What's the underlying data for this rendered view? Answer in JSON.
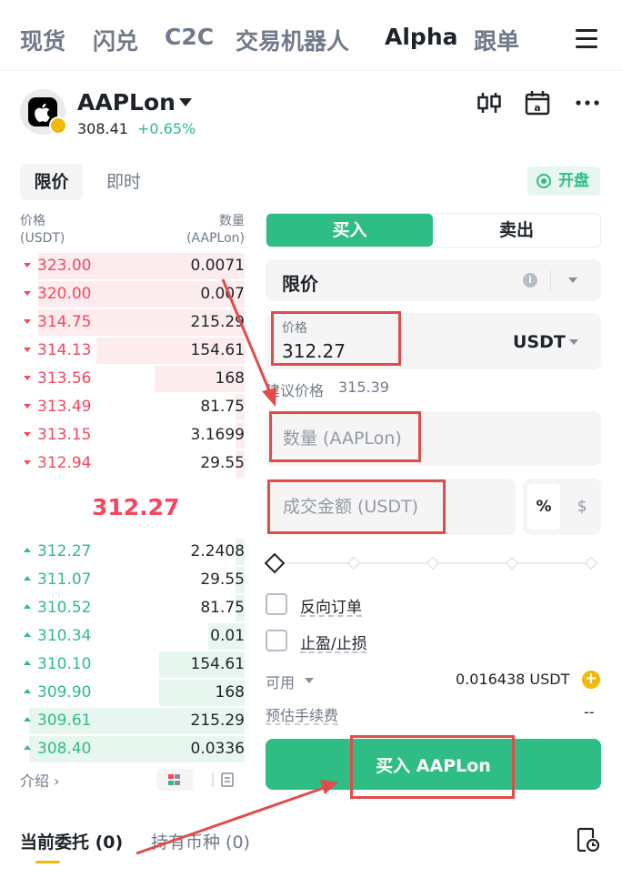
{
  "nav": {
    "tabs": [
      {
        "label": "现货"
      },
      {
        "label": "闪兑"
      },
      {
        "label": "C2C"
      },
      {
        "label": "交易机器人"
      },
      {
        "label": "Alpha"
      },
      {
        "label": "跟单"
      }
    ],
    "active_tab": "Alpha",
    "menu_icon": "hamburger-menu-icon"
  },
  "token": {
    "symbol": "AAPLon",
    "price": "308.41",
    "change": "+0.65%",
    "logo_icon": "apple-logo-icon",
    "header_icons": [
      "candlestick-icon",
      "calendar-icon",
      "more-icon"
    ]
  },
  "order_mode": {
    "limit_label": "限价",
    "market_label": "即时",
    "status_label": "开盘"
  },
  "orderbook": {
    "price_header": "价格",
    "price_unit": "(USDT)",
    "qty_header": "数量",
    "qty_unit": "(AAPLon)",
    "asks": [
      {
        "price": "323.00",
        "qty": "0.0071",
        "depth": 0.92
      },
      {
        "price": "320.00",
        "qty": "0.007",
        "depth": 0.92
      },
      {
        "price": "314.75",
        "qty": "215.29",
        "depth": 0.92
      },
      {
        "price": "314.13",
        "qty": "154.61",
        "depth": 0.66
      },
      {
        "price": "313.56",
        "qty": "168",
        "depth": 0.4
      },
      {
        "price": "313.49",
        "qty": "81.75",
        "depth": 0.04
      },
      {
        "price": "313.15",
        "qty": "3.1699",
        "depth": 0.04
      },
      {
        "price": "312.94",
        "qty": "29.55",
        "depth": 0.04
      }
    ],
    "mid_price": "312.27",
    "bids": [
      {
        "price": "312.27",
        "qty": "2.2408",
        "depth": 0.04
      },
      {
        "price": "311.07",
        "qty": "29.55",
        "depth": 0.04
      },
      {
        "price": "310.52",
        "qty": "81.75",
        "depth": 0.04
      },
      {
        "price": "310.34",
        "qty": "0.01",
        "depth": 0.16
      },
      {
        "price": "310.10",
        "qty": "154.61",
        "depth": 0.38
      },
      {
        "price": "309.90",
        "qty": "168",
        "depth": 0.38
      },
      {
        "price": "309.61",
        "qty": "215.29",
        "depth": 0.96
      },
      {
        "price": "308.40",
        "qty": "0.0336",
        "depth": 0.96
      }
    ],
    "intro_label": "介绍 ›"
  },
  "form": {
    "buy_label": "买入",
    "sell_label": "卖出",
    "order_type": "限价",
    "price_label": "价格",
    "price_value": "312.27",
    "price_unit": "USDT",
    "suggest_label": "建议价格",
    "suggest_value": "315.39",
    "qty_placeholder": "数量 (AAPLon)",
    "amount_placeholder": "成交金额 (USDT)",
    "pct_label": "%",
    "dollar_label": "$",
    "reverse_label": "反向订单",
    "tpsl_label": "止盈/止损",
    "available_label": "可用",
    "available_value": "0.016438 USDT",
    "fee_label": "预估手续费",
    "fee_value": "--",
    "submit_label": "买入 AAPLon"
  },
  "bottom_tabs": {
    "open_orders": "当前委托 (0)",
    "holdings": "持有币种 (0)",
    "history_icon": "order-history-icon"
  },
  "colors": {
    "buy": "#2ebd85",
    "sell": "#f6465d",
    "accent": "#f0b90b",
    "annotation": "#e14b4b"
  }
}
